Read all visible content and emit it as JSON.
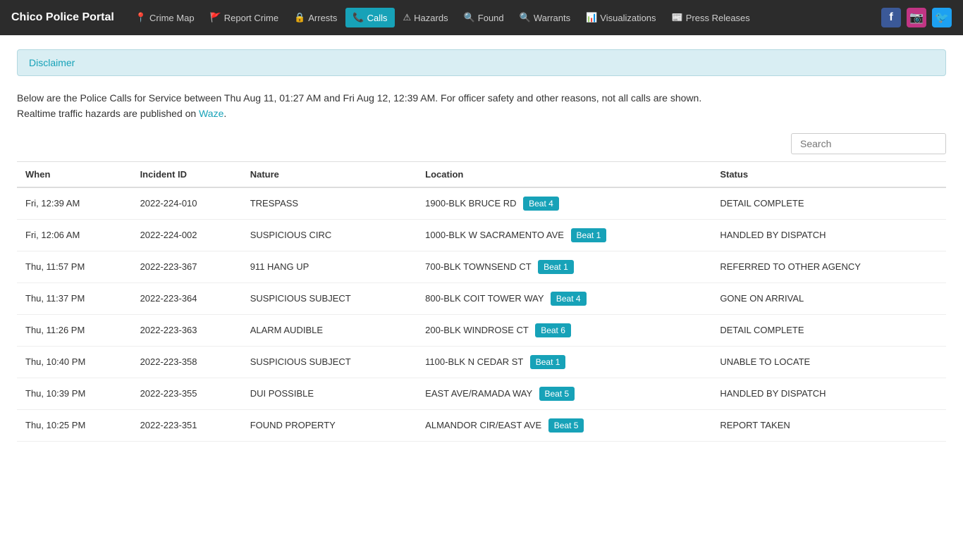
{
  "app": {
    "brand": "Chico Police Portal"
  },
  "navbar": {
    "links": [
      {
        "label": "Crime Map",
        "icon": "📍",
        "active": false
      },
      {
        "label": "Report Crime",
        "icon": "🚩",
        "active": false
      },
      {
        "label": "Arrests",
        "icon": "🔒",
        "active": false
      },
      {
        "label": "Calls",
        "icon": "📞",
        "active": true
      },
      {
        "label": "Hazards",
        "icon": "⚠",
        "active": false
      },
      {
        "label": "Found",
        "icon": "🔍",
        "active": false
      },
      {
        "label": "Warrants",
        "icon": "🔍",
        "active": false
      },
      {
        "label": "Visualizations",
        "icon": "📊",
        "active": false
      },
      {
        "label": "Press Releases",
        "icon": "📰",
        "active": false
      }
    ]
  },
  "disclaimer": {
    "title": "Disclaimer",
    "body_part1": "Below are the Police Calls for Service between Thu Aug 11, 01:27 AM and Fri Aug 12, 12:39 AM. For officer safety and other reasons, not all calls are shown.",
    "body_part2": "Realtime traffic hazards are published on ",
    "waze_link": "Waze",
    "body_part3": "."
  },
  "search": {
    "placeholder": "Search"
  },
  "table": {
    "columns": [
      "When",
      "Incident ID",
      "Nature",
      "Location",
      "Status"
    ],
    "rows": [
      {
        "when": "Fri, 12:39 AM",
        "incident_id": "2022-224-010",
        "nature": "TRESPASS",
        "location": "1900-BLK BRUCE RD",
        "beat": "Beat 4",
        "beat_class": "beat-4",
        "status": "DETAIL COMPLETE"
      },
      {
        "when": "Fri, 12:06 AM",
        "incident_id": "2022-224-002",
        "nature": "SUSPICIOUS CIRC",
        "location": "1000-BLK W SACRAMENTO AVE",
        "beat": "Beat 1",
        "beat_class": "beat-1",
        "status": "HANDLED BY DISPATCH"
      },
      {
        "when": "Thu, 11:57 PM",
        "incident_id": "2022-223-367",
        "nature": "911 HANG UP",
        "location": "700-BLK TOWNSEND CT",
        "beat": "Beat 1",
        "beat_class": "beat-1",
        "status": "REFERRED TO OTHER AGENCY"
      },
      {
        "when": "Thu, 11:37 PM",
        "incident_id": "2022-223-364",
        "nature": "SUSPICIOUS SUBJECT",
        "location": "800-BLK COIT TOWER WAY",
        "beat": "Beat 4",
        "beat_class": "beat-4",
        "status": "GONE ON ARRIVAL"
      },
      {
        "when": "Thu, 11:26 PM",
        "incident_id": "2022-223-363",
        "nature": "ALARM AUDIBLE",
        "location": "200-BLK WINDROSE CT",
        "beat": "Beat 6",
        "beat_class": "beat-6",
        "status": "DETAIL COMPLETE"
      },
      {
        "when": "Thu, 10:40 PM",
        "incident_id": "2022-223-358",
        "nature": "SUSPICIOUS SUBJECT",
        "location": "1100-BLK N CEDAR ST",
        "beat": "Beat 1",
        "beat_class": "beat-1",
        "status": "UNABLE TO LOCATE"
      },
      {
        "when": "Thu, 10:39 PM",
        "incident_id": "2022-223-355",
        "nature": "DUI POSSIBLE",
        "location": "EAST AVE/RAMADA WAY",
        "beat": "Beat 5",
        "beat_class": "beat-5",
        "status": "HANDLED BY DISPATCH"
      },
      {
        "when": "Thu, 10:25 PM",
        "incident_id": "2022-223-351",
        "nature": "FOUND PROPERTY",
        "location": "ALMANDOR CIR/EAST AVE",
        "beat": "Beat 5",
        "beat_class": "beat-5",
        "status": "REPORT TAKEN"
      }
    ]
  }
}
